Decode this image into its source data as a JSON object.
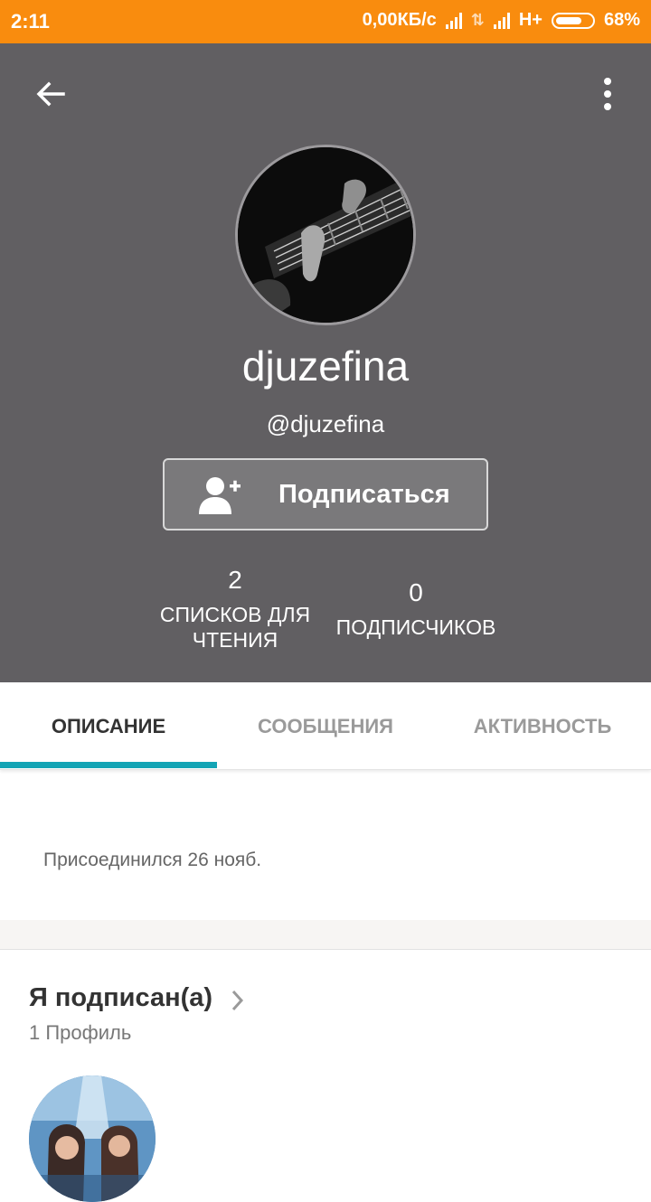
{
  "status_bar": {
    "time": "2:11",
    "network_speed": "0,00КБ/с",
    "network_type": "H+",
    "battery_percent": "68%"
  },
  "profile": {
    "name": "djuzefina",
    "handle": "@djuzefina",
    "follow_button_label": "Подписаться",
    "stats": {
      "reading_lists": {
        "count": "2",
        "label": "СПИСКОВ ДЛЯ ЧТЕНИЯ"
      },
      "followers": {
        "count": "0",
        "label": "ПОДПИСЧИКОВ"
      }
    }
  },
  "tabs": [
    {
      "label": "ОПИСАНИЕ",
      "active": true
    },
    {
      "label": "СООБЩЕНИЯ",
      "active": false
    },
    {
      "label": "АКТИВНОСТЬ",
      "active": false
    }
  ],
  "about": {
    "joined_text": "Присоединился 26 нояб."
  },
  "following": {
    "title": "Я подписан(а)",
    "count_text": "1 Профиль"
  },
  "icons": {
    "back": "arrow-left-icon",
    "menu": "more-vertical-icon",
    "follow": "add-user-icon",
    "chevron": "chevron-right-icon"
  },
  "colors": {
    "status_bar": "#f98c0e",
    "header_bg": "#615f62",
    "tab_indicator": "#13a4b5"
  }
}
